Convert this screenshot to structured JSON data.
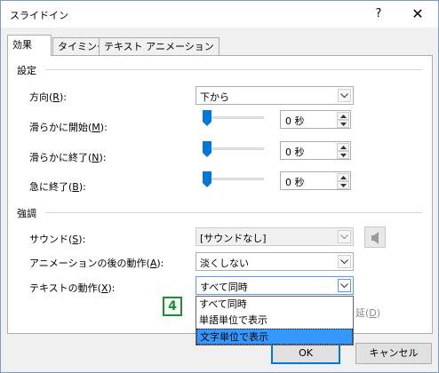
{
  "window": {
    "title": "スライドイン",
    "help": "?",
    "close": "✕"
  },
  "tabs": [
    {
      "label": "効果"
    },
    {
      "label": "タイミング"
    },
    {
      "label": "テキスト アニメーション"
    }
  ],
  "settings": {
    "group": "設定",
    "direction": {
      "label": "方向(",
      "key": "R",
      "end": "):",
      "value": "下から"
    },
    "smooth_start": {
      "label": "滑らかに開始(",
      "key": "M",
      "end": "):",
      "value": "0 秒"
    },
    "smooth_end": {
      "label": "滑らかに終了(",
      "key": "N",
      "end": "):",
      "value": "0 秒"
    },
    "bounce_end": {
      "label": "急に終了(",
      "key": "B",
      "end": "):",
      "value": "0 秒"
    }
  },
  "enhancements": {
    "group": "強調",
    "sound": {
      "label": "サウンド(",
      "key": "S",
      "end": "):",
      "value": "[サウンドなし]"
    },
    "after_animation": {
      "label": "アニメーションの後の動作(",
      "key": "A",
      "end": "):",
      "value": "淡くしない"
    },
    "animate_text": {
      "label": "テキストの動作(",
      "key": "X",
      "end": "):",
      "value": "すべて同時"
    },
    "hidden_suffix": "延(",
    "hidden_key": "D",
    "hidden_end": ")"
  },
  "dropdown": {
    "options": [
      "すべて同時",
      "単語単位で表示",
      "文字単位で表示"
    ],
    "selected_index": 2
  },
  "badge": "4",
  "buttons": {
    "ok": "OK",
    "cancel": "キャンセル"
  },
  "colors": {
    "accent": "#0078d7",
    "highlight": "#3399ff",
    "badge": "#1e8a3a"
  }
}
